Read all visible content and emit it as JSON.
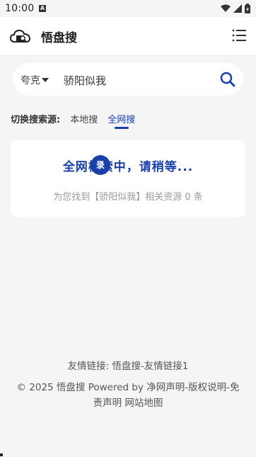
{
  "status_bar": {
    "time": "10:00",
    "notification_icon": "A"
  },
  "header": {
    "title": "悟盘搜",
    "logo_icon": "cloud-search-icon",
    "menu_icon": "list-menu-icon"
  },
  "search": {
    "engine": "夸克",
    "query": "骄阳似我",
    "button_icon": "search-icon"
  },
  "source": {
    "label": "切换搜索源:",
    "tabs": [
      "本地搜",
      "全网搜"
    ],
    "active_tab": "全网搜"
  },
  "result": {
    "status_text": "全网检索中，请稍等...",
    "spinner_text": "录",
    "count_text": "为您找到【骄阳似我】相关资源 0 条"
  },
  "footer": {
    "links_line": "友情链接: 悟盘搜-友情链接1",
    "copyright_line": "© 2025 悟盘搜 Powered by 净网声明-版权说明-免责声明 网站地图"
  },
  "colors": {
    "accent": "#1a3fa8",
    "background": "#f5f5f5",
    "card": "#ffffff"
  }
}
